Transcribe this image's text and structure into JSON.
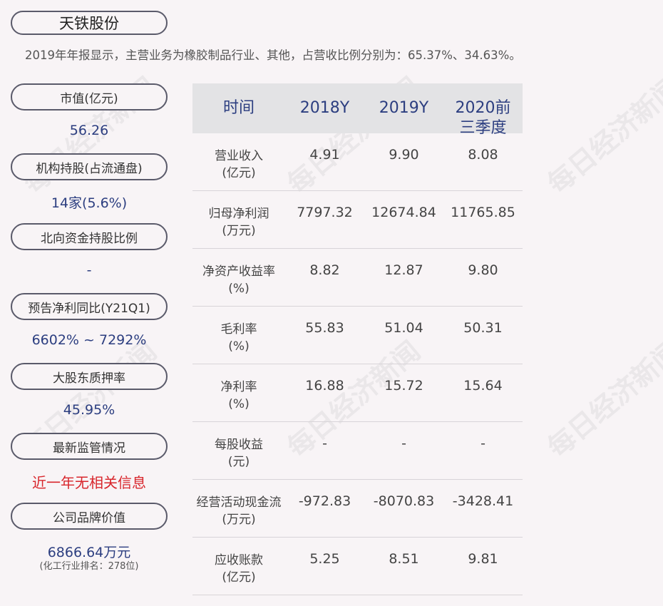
{
  "company": "天铁股份",
  "summary": "2019年年报显示，主营业务为橡胶制品行业、其他，占营收比例分别为：65.37%、34.63%。",
  "metrics": [
    {
      "label": "市值(亿元)",
      "value": "56.26"
    },
    {
      "label": "机构持股(占流通盘)",
      "value": "14家(5.6%)"
    },
    {
      "label": "北向资金持股比例",
      "value": "-"
    },
    {
      "label": "预告净利同比(Y21Q1)",
      "value": "6602% ~ 7292%"
    },
    {
      "label": "大股东质押率",
      "value": "45.95%"
    },
    {
      "label": "最新监管情况",
      "value": "近一年无相关信息"
    },
    {
      "label": "公司品牌价值",
      "value": "6866.64万元",
      "sub": "(化工行业排名：278位)"
    }
  ],
  "table": {
    "headers": [
      "时间",
      "2018Y",
      "2019Y",
      "2020前三季度"
    ],
    "rows": [
      {
        "label1": "营业收入",
        "label2": "(亿元)",
        "v": [
          "4.91",
          "9.90",
          "8.08"
        ]
      },
      {
        "label1": "归母净利润",
        "label2": "(万元)",
        "v": [
          "7797.32",
          "12674.84",
          "11765.85"
        ]
      },
      {
        "label1": "净资产收益率",
        "label2": "(%)",
        "v": [
          "8.82",
          "12.87",
          "9.80"
        ]
      },
      {
        "label1": "毛利率",
        "label2": "(%)",
        "v": [
          "55.83",
          "51.04",
          "50.31"
        ]
      },
      {
        "label1": "净利率",
        "label2": "(%)",
        "v": [
          "16.88",
          "15.72",
          "15.64"
        ]
      },
      {
        "label1": "每股收益",
        "label2": "(元)",
        "v": [
          "-",
          "-",
          "-"
        ]
      },
      {
        "label1": "经营活动现金流",
        "label2": "(万元)",
        "v": [
          "-972.83",
          "-8070.83",
          "-3428.41"
        ]
      },
      {
        "label1": "应收账款",
        "label2": "(亿元)",
        "v": [
          "5.25",
          "8.51",
          "9.81"
        ]
      }
    ]
  },
  "watermark": "每日经济新闻"
}
